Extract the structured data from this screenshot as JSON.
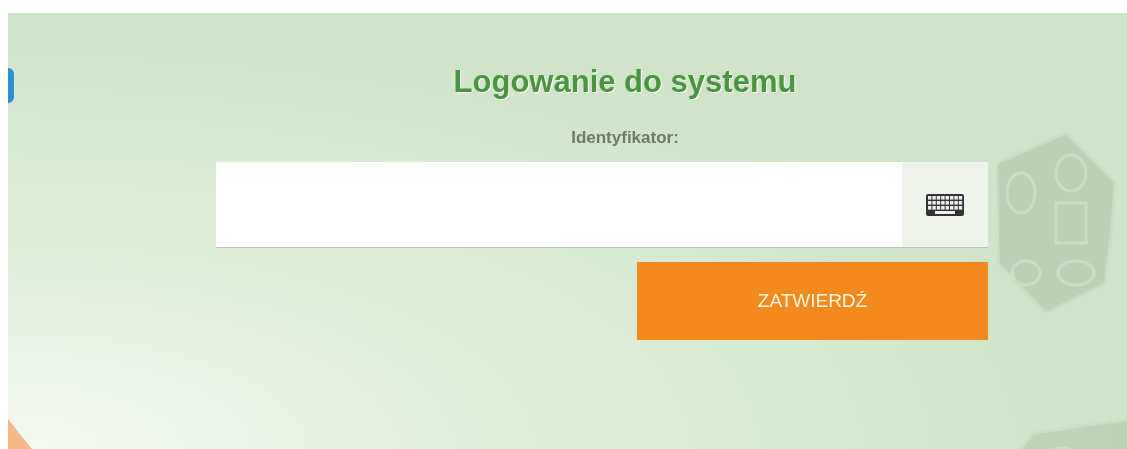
{
  "login": {
    "title": "Logowanie do systemu",
    "id_field": {
      "label": "Identyfikator:"
    },
    "submit_button": "ZATWIERDŹ"
  }
}
